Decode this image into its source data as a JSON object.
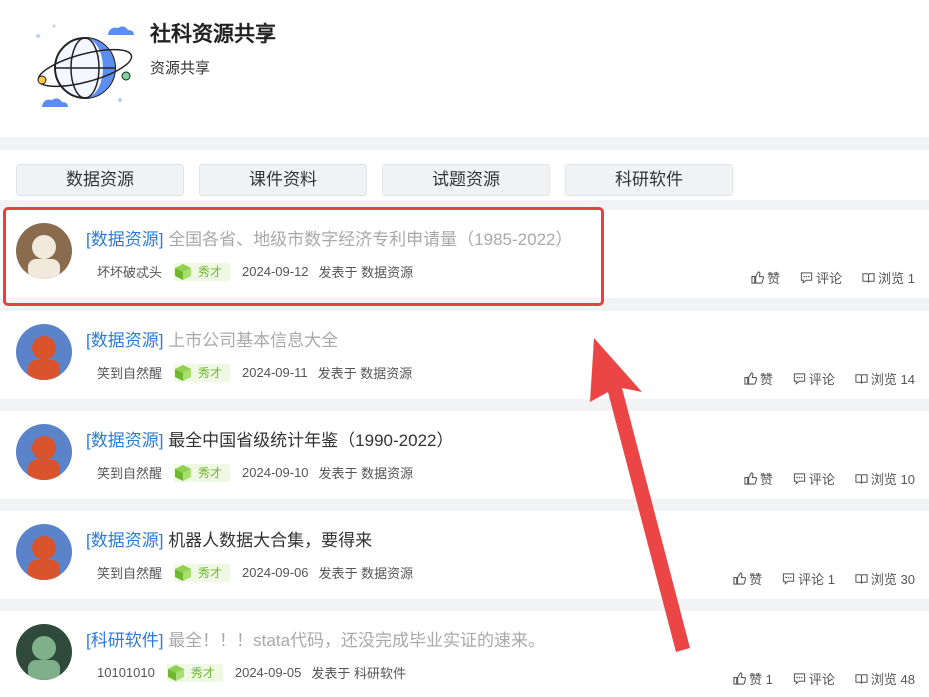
{
  "header": {
    "title": "社科资源共享",
    "subtitle": "资源共享"
  },
  "tabs": [
    {
      "label": "数据资源"
    },
    {
      "label": "课件资料"
    },
    {
      "label": "试题资源"
    },
    {
      "label": "科研软件"
    }
  ],
  "posts": [
    {
      "category": "[数据资源]",
      "title": "全国各省、地级市数字经济专利申请量（1985-2022）",
      "title_read": true,
      "author": "坏坏破忒头",
      "badge": "秀才",
      "date": "2024-09-12",
      "posted_in": "发表于 数据资源",
      "like": "赞",
      "comment": "评论",
      "views": "浏览 1"
    },
    {
      "category": "[数据资源]",
      "title": "上市公司基本信息大全",
      "title_read": true,
      "author": "笑到自然醒",
      "badge": "秀才",
      "date": "2024-09-11",
      "posted_in": "发表于 数据资源",
      "like": "赞",
      "comment": "评论",
      "views": "浏览 14"
    },
    {
      "category": "[数据资源]",
      "title": "最全中国省级统计年鉴（1990-2022）",
      "title_read": false,
      "author": "笑到自然醒",
      "badge": "秀才",
      "date": "2024-09-10",
      "posted_in": "发表于 数据资源",
      "like": "赞",
      "comment": "评论",
      "views": "浏览 10"
    },
    {
      "category": "[数据资源]",
      "title": "机器人数据大合集，要得来",
      "title_read": false,
      "author": "笑到自然醒",
      "badge": "秀才",
      "date": "2024-09-06",
      "posted_in": "发表于 数据资源",
      "like": "赞",
      "comment": "评论 1",
      "views": "浏览 30"
    },
    {
      "category": "[科研软件]",
      "title": "最全！！！stata代码，还没完成毕业实证的速来。",
      "title_read": true,
      "author": "10101010",
      "badge": "秀才",
      "date": "2024-09-05",
      "posted_in": "发表于 科研软件",
      "like": "赞 1",
      "comment": "评论",
      "views": "浏览 48"
    }
  ],
  "colors": {
    "category_link": "#2d7bd8",
    "read_title": "#a9a9a9",
    "badge_green": "#6fb72c",
    "annotation_red": "#e84040"
  }
}
